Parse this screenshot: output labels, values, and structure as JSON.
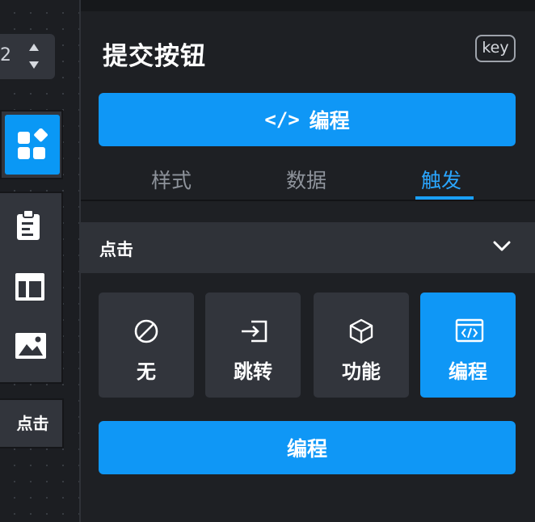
{
  "theme": {
    "accent": "#0f97f6",
    "panel_bg": "#1e2024",
    "card_bg": "#32353c",
    "active_tab": "#2aa6ff",
    "muted_text": "#8e939b"
  },
  "left_strip": {
    "stepper_value": "2",
    "widget_icon": "widgets-icon",
    "tools": [
      "clipboard-icon",
      "layout-icon",
      "image-icon"
    ],
    "event_chip_label": "点击"
  },
  "panel": {
    "title": "提交按钮",
    "key_badge": "key",
    "code_button": {
      "glyph": "</>",
      "label": "编程"
    },
    "tabs": [
      {
        "label": "样式",
        "active": false
      },
      {
        "label": "数据",
        "active": false
      },
      {
        "label": "触发",
        "active": true
      }
    ],
    "event": {
      "label": "点击",
      "icon": "chevron-down-icon"
    },
    "actions": [
      {
        "label": "无",
        "icon": "ban-icon",
        "active": false
      },
      {
        "label": "跳转",
        "icon": "jump-icon",
        "active": false
      },
      {
        "label": "功能",
        "icon": "cube-icon",
        "active": false
      },
      {
        "label": "编程",
        "icon": "code-window-icon",
        "active": true
      }
    ],
    "bottom_button_label": "编程"
  }
}
